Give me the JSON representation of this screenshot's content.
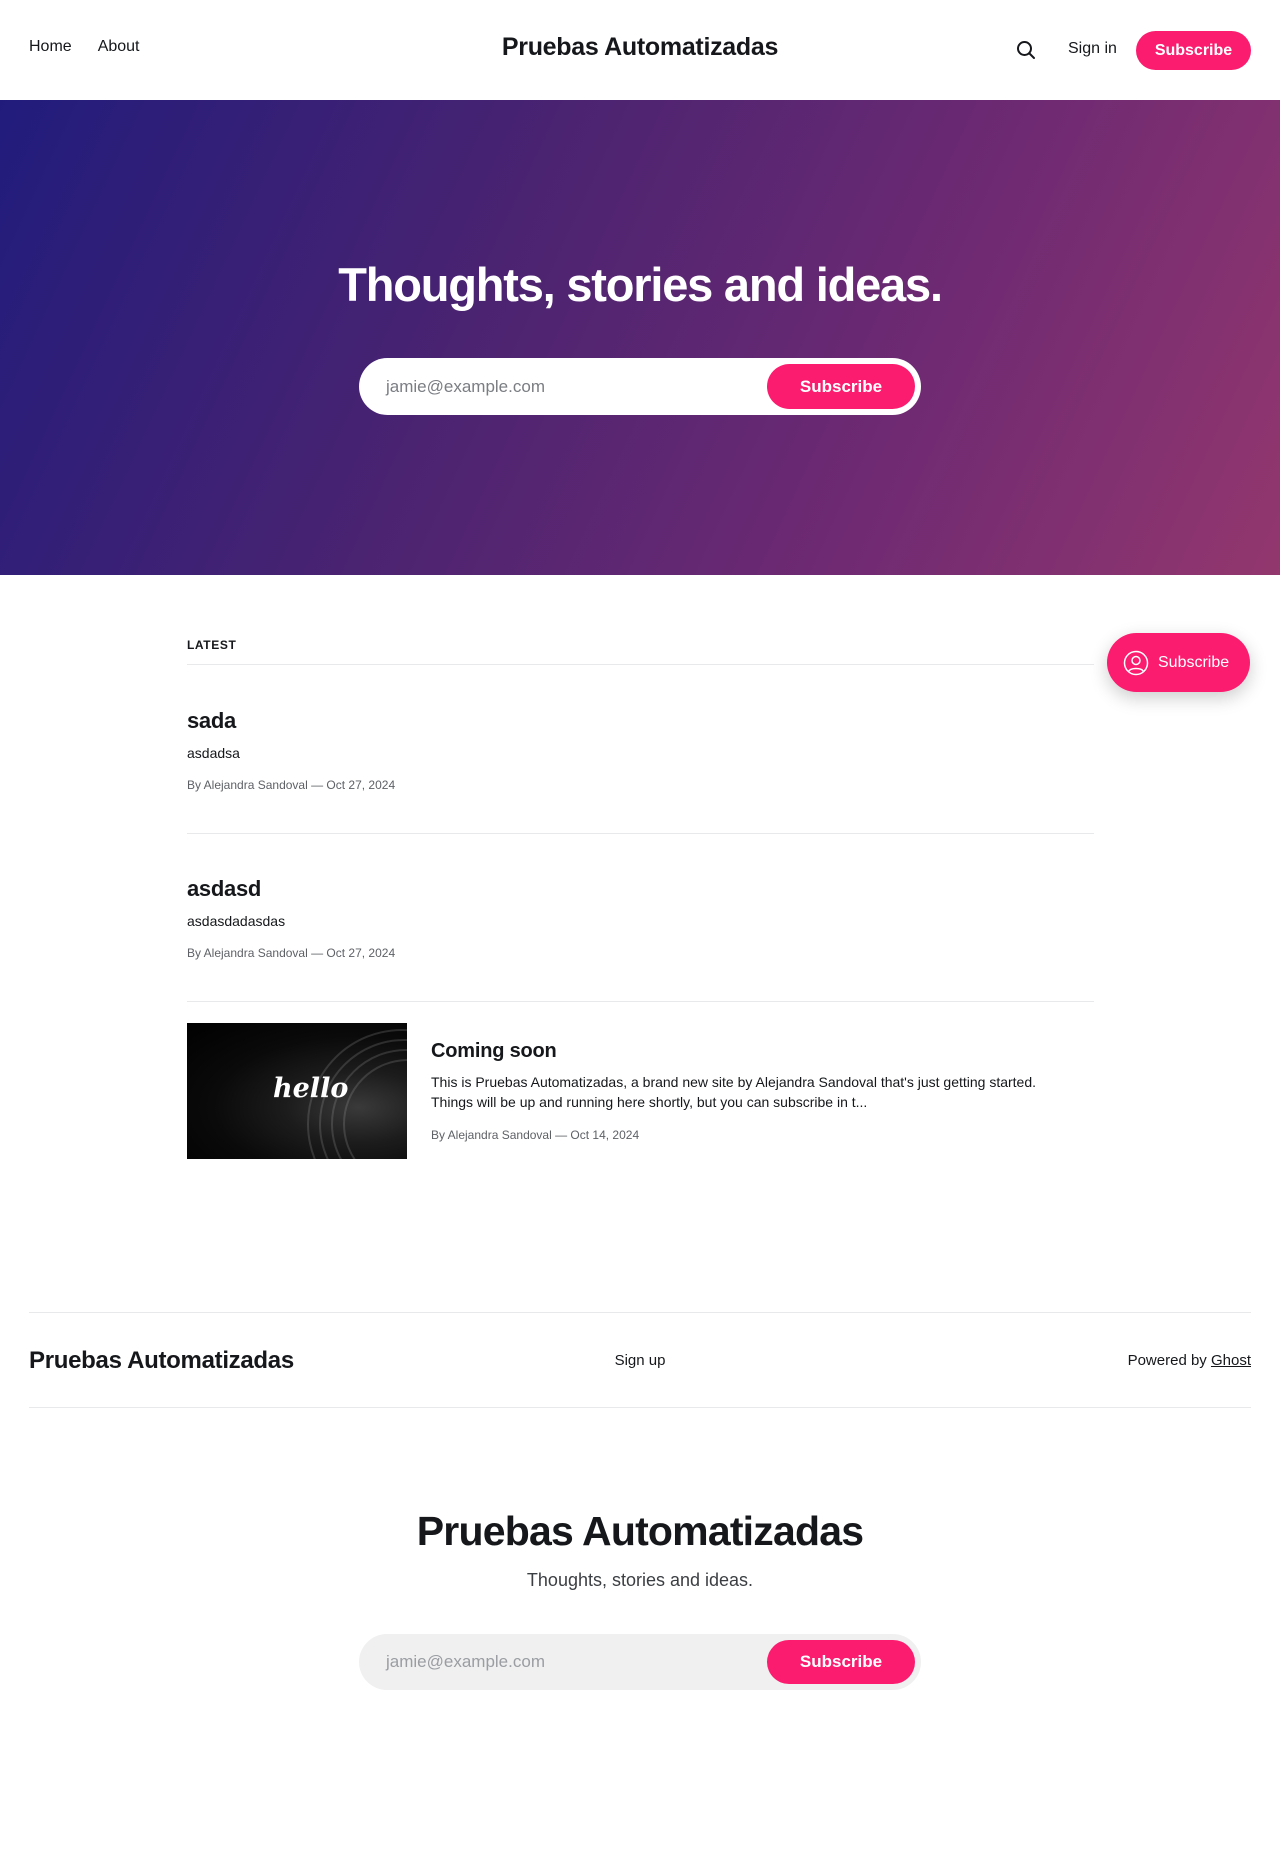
{
  "header": {
    "nav": [
      "Home",
      "About"
    ],
    "site_title": "Pruebas Automatizadas",
    "search_icon": "search-icon",
    "signin_label": "Sign in",
    "subscribe_label": "Subscribe"
  },
  "hero": {
    "title": "Thoughts, stories and ideas.",
    "email_placeholder": "jamie@example.com",
    "subscribe_label": "Subscribe",
    "gradient_start": "#211c7c",
    "gradient_end": "#93376e"
  },
  "latest": {
    "heading": "LATEST",
    "posts": [
      {
        "title": "sada",
        "excerpt": "asdadsa",
        "meta": "By Alejandra Sandoval — Oct 27, 2024"
      },
      {
        "title": "asdasd",
        "excerpt": "asdasdadasdas",
        "meta": "By Alejandra Sandoval — Oct 27, 2024"
      },
      {
        "title": "Coming soon",
        "excerpt": "This is Pruebas Automatizadas, a brand new site by Alejandra Sandoval that's just getting started. Things will be up and running here shortly, but you can subscribe in t...",
        "meta": "By Alejandra Sandoval — Oct 14, 2024",
        "image_text": "hello"
      }
    ]
  },
  "floating_subscribe": {
    "label": "Subscribe",
    "icon": "user-circle-icon"
  },
  "footer": {
    "site_title": "Pruebas Automatizadas",
    "signup_label": "Sign up",
    "powered_prefix": "Powered by",
    "powered_link": "Ghost"
  },
  "cta": {
    "title": "Pruebas Automatizadas",
    "description": "Thoughts, stories and ideas.",
    "email_placeholder": "jamie@example.com",
    "subscribe_label": "Subscribe"
  },
  "colors": {
    "accent": "#fb1c6f",
    "text": "#15171a",
    "meta": "#5e6166"
  }
}
